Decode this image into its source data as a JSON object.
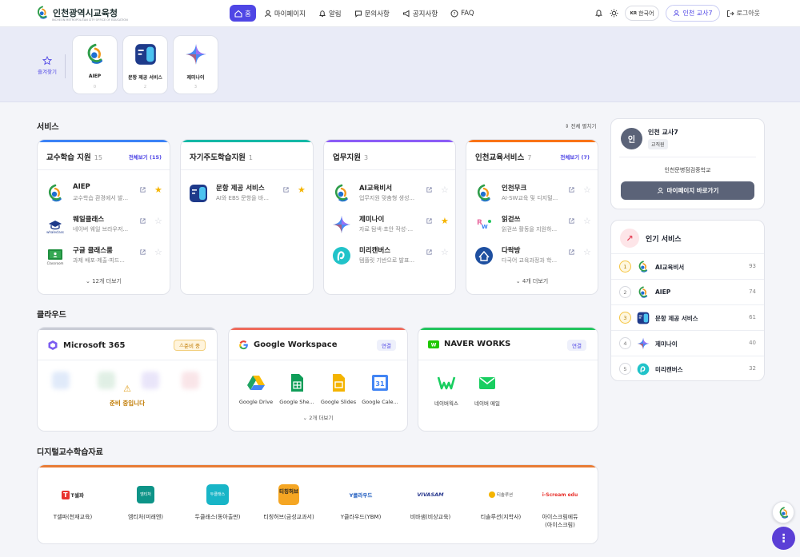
{
  "header": {
    "logo_text": "인천광역시교육청",
    "logo_sub": "INCHEON METROPOLITAN CITY OFFICE OF EDUCATION",
    "nav": [
      "홈",
      "마이페이지",
      "알림",
      "문의사항",
      "공지사항",
      "FAQ"
    ],
    "lang_code": "KR",
    "lang": "한국어",
    "user": "인천 교사7",
    "logout": "로그아웃"
  },
  "favorites": {
    "label": "즐겨찾기",
    "items": [
      {
        "name": "AIEP",
        "count": "0"
      },
      {
        "name": "문항 제공 서비스",
        "count": "2"
      },
      {
        "name": "제미나이",
        "count": "3"
      }
    ]
  },
  "services": {
    "title": "서비스",
    "expand_all": "전체 펼치기",
    "cards": [
      {
        "title": "교수학습 지원",
        "count": "15",
        "view_all": "전체보기 (15)",
        "more": "12개 더보기",
        "items": [
          {
            "name": "AIEP",
            "desc": "교수학습 환경에서 발...",
            "star": true
          },
          {
            "name": "웨일클래스",
            "desc": "네이버 웨일 브라우저...",
            "star": false
          },
          {
            "name": "구글 클래스룸",
            "desc": "과제 배포·제출·피드...",
            "star": false
          }
        ]
      },
      {
        "title": "자기주도학습지원",
        "count": "1",
        "view_all": "",
        "more": "",
        "items": [
          {
            "name": "문항 제공 서비스",
            "desc": "AI와 EBS 문항을 바...",
            "star": true
          }
        ]
      },
      {
        "title": "업무지원",
        "count": "3",
        "view_all": "",
        "more": "",
        "items": [
          {
            "name": "AI교육비서",
            "desc": "업무지원 맞춤형 생성...",
            "star": false
          },
          {
            "name": "제미나이",
            "desc": "자료 탐색·초안 작성·...",
            "star": true
          },
          {
            "name": "미리캔버스",
            "desc": "템플릿 기반으로 발표...",
            "star": false
          }
        ]
      },
      {
        "title": "인천교육서비스",
        "count": "7",
        "view_all": "전체보기 (7)",
        "more": "4개 더보기",
        "items": [
          {
            "name": "인천무크",
            "desc": "AI·SW교육 및 디지털...",
            "star": false
          },
          {
            "name": "읽걷쓰",
            "desc": "읽걷쓰 활동을 지원하...",
            "star": false
          },
          {
            "name": "다락방",
            "desc": "다국어 교육과정과 학...",
            "star": false
          }
        ]
      }
    ]
  },
  "cloud": {
    "title": "클라우드",
    "ms": {
      "name": "Microsoft 365",
      "badge": "준비 중",
      "notice": "준비 중입니다"
    },
    "google": {
      "name": "Google Workspace",
      "badge": "연결",
      "more": "2개 더보기",
      "apps": [
        "Google Drive",
        "Google She...",
        "Google Slides",
        "Google Cale..."
      ]
    },
    "naver": {
      "name": "NAVER WORKS",
      "badge": "연결",
      "apps": [
        "네이버웍스",
        "네이버 메일"
      ]
    }
  },
  "digital": {
    "title": "디지털교수학습자료",
    "items": [
      {
        "name": "T셀파(천재교육)",
        "logo": "T셀파"
      },
      {
        "name": "엠티처(미래엔)",
        "logo": "엠티처"
      },
      {
        "name": "두클래스(동아출판)",
        "logo": "두클래스"
      },
      {
        "name": "티칭허브(금성교과서)",
        "logo": "티칭허브"
      },
      {
        "name": "Y클라우드(YBM)",
        "logo": "Y클라우드"
      },
      {
        "name": "비바샘(비상교육)",
        "logo": "VIVASAM"
      },
      {
        "name": "티솔루션(지학사)",
        "logo": "티솔루션"
      },
      {
        "name": "아이스크림에듀(아이스크림)",
        "name1": "아이스크림에듀",
        "name2": "(아이스크림)",
        "logo": "i-Scream edu"
      }
    ]
  },
  "profile": {
    "avatar": "인",
    "name": "인천 교사7",
    "role": "교직원",
    "school": "인천문병점검중학교",
    "button": "마이페이지 바로가기"
  },
  "popular": {
    "title": "인기 서비스",
    "items": [
      {
        "rank": "1",
        "name": "AI교육비서",
        "count": "93"
      },
      {
        "rank": "2",
        "name": "AIEP",
        "count": "74"
      },
      {
        "rank": "3",
        "name": "문항 제공 서비스",
        "count": "61"
      },
      {
        "rank": "4",
        "name": "제미나이",
        "count": "40"
      },
      {
        "rank": "5",
        "name": "미리캔버스",
        "count": "32"
      }
    ]
  },
  "colors": {
    "accent": "#4f46e5",
    "bar_blue": "#3b82f6",
    "bar_teal": "#14b8a6",
    "bar_purple": "#8b5cf6",
    "bar_orange": "#f97316"
  }
}
